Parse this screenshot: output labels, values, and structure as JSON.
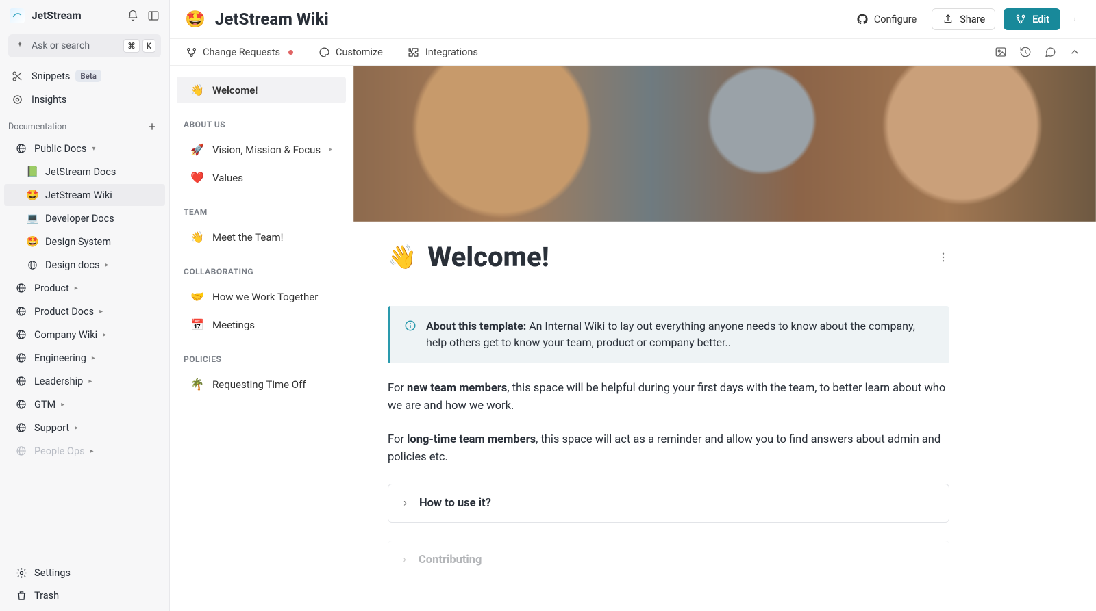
{
  "sidebar": {
    "workspace": "JetStream",
    "search_placeholder": "Ask or search",
    "search_kbd1": "⌘",
    "search_kbd2": "K",
    "snippets_label": "Snippets",
    "snippets_badge": "Beta",
    "insights_label": "Insights",
    "docs_section": "Documentation",
    "public_docs": "Public Docs",
    "spaces": [
      {
        "emoji": "📗",
        "label": "JetStream Docs"
      },
      {
        "emoji": "🤩",
        "label": "JetStream Wiki",
        "active": true
      },
      {
        "emoji": "💻",
        "label": "Developer Docs"
      },
      {
        "emoji": "🤩",
        "label": "Design System"
      },
      {
        "emoji": "",
        "label": "Design docs",
        "icon": true,
        "caret": true
      }
    ],
    "groups": [
      {
        "label": "Product"
      },
      {
        "label": "Product Docs"
      },
      {
        "label": "Company Wiki"
      },
      {
        "label": "Engineering"
      },
      {
        "label": "Leadership"
      },
      {
        "label": "GTM"
      },
      {
        "label": "Support"
      },
      {
        "label": "People Ops",
        "faded": true
      }
    ],
    "settings": "Settings",
    "trash": "Trash"
  },
  "header": {
    "emoji": "🤩",
    "title": "JetStream Wiki",
    "configure": "Configure",
    "share": "Share",
    "edit": "Edit"
  },
  "subheader": {
    "change_requests": "Change Requests",
    "customize": "Customize",
    "integrations": "Integrations"
  },
  "pagenav": {
    "items": [
      {
        "section": null,
        "emoji": "👋",
        "label": "Welcome!",
        "active": true
      },
      {
        "section": "ABOUT US"
      },
      {
        "emoji": "🚀",
        "label": "Vision, Mission & Focus",
        "caret": true
      },
      {
        "emoji": "❤️",
        "label": "Values"
      },
      {
        "section": "TEAM"
      },
      {
        "emoji": "👋",
        "label": "Meet the Team!"
      },
      {
        "section": "COLLABORATING"
      },
      {
        "emoji": "🤝",
        "label": "How we Work Together"
      },
      {
        "emoji": "📅",
        "label": "Meetings"
      },
      {
        "section": "POLICIES"
      },
      {
        "emoji": "🌴",
        "label": "Requesting Time Off"
      }
    ]
  },
  "page": {
    "title_emoji": "👋",
    "title": "Welcome!",
    "callout_bold": "About this template:",
    "callout_rest": " An Internal Wiki to lay out everything anyone needs to know about the company, help others get to know your team, product or company better..",
    "p1_a": "For ",
    "p1_b": "new team members",
    "p1_c": ", this space will be helpful during your first days with the team, to better learn about who we are and how we work.",
    "p2_a": "For ",
    "p2_b": "long-time team members",
    "p2_c": ", this space will act as a reminder and allow you to find answers about admin and policies etc.",
    "expander1": "How to use it?",
    "expander2": "Contributing"
  }
}
